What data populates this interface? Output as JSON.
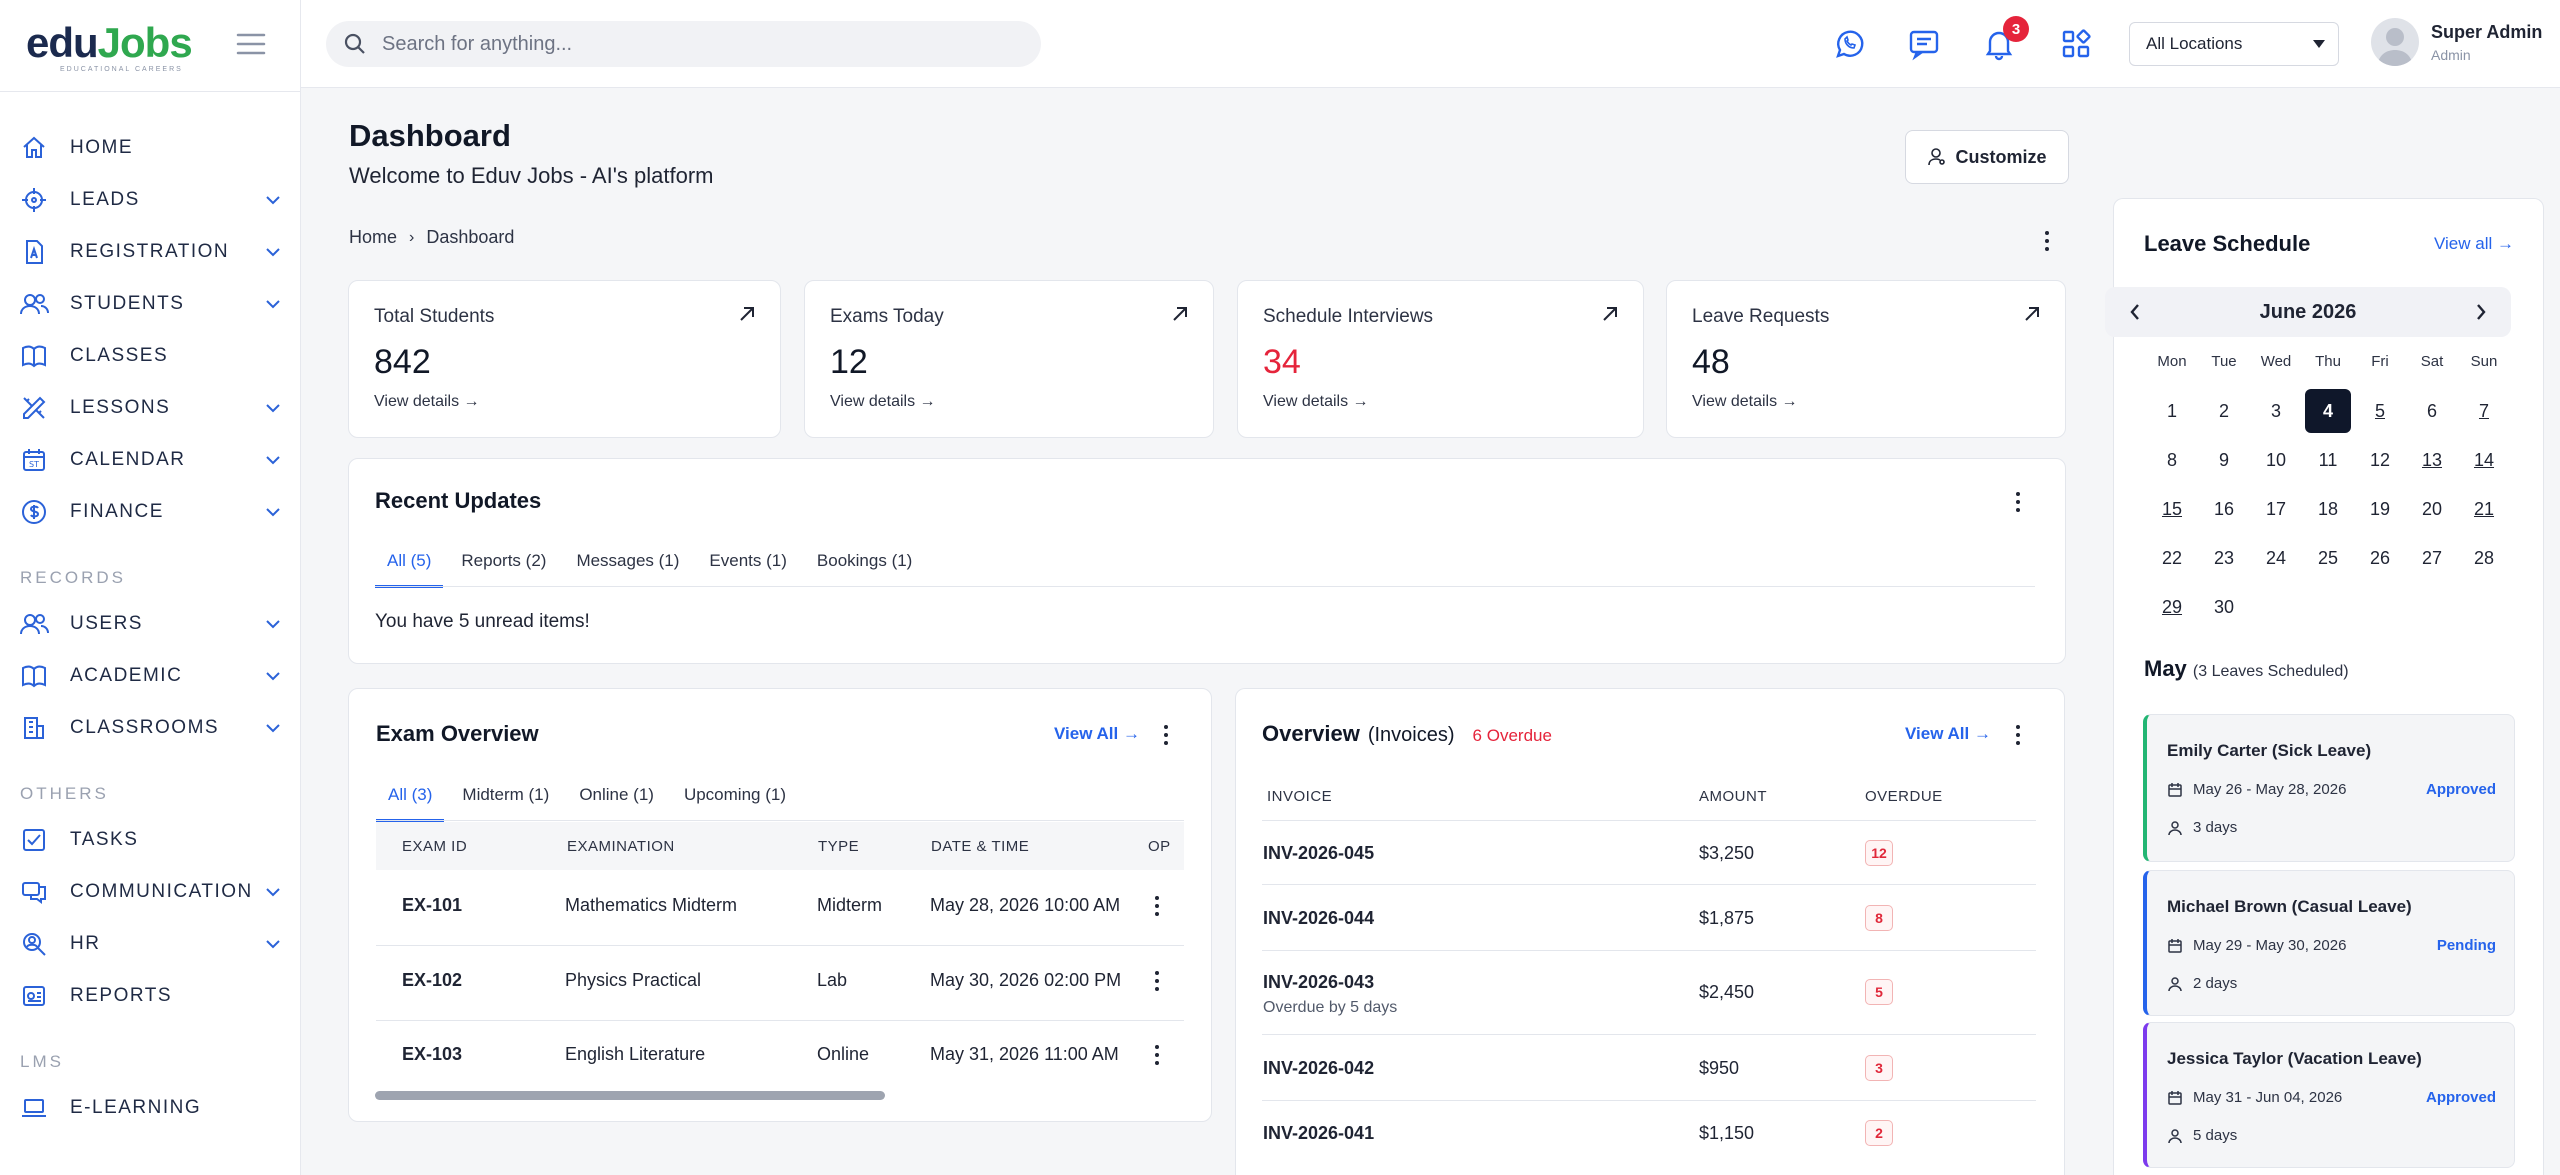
{
  "brand": {
    "logo_part1": "edu",
    "logo_part2": "Jobs",
    "logo_sub": "EDUCATIONAL CAREERS"
  },
  "sidebar": {
    "groups": [
      {
        "items": [
          {
            "label": "HOME",
            "icon": "home-icon",
            "expandable": false
          },
          {
            "label": "LEADS",
            "icon": "target-icon",
            "expandable": true
          },
          {
            "label": "REGISTRATION",
            "icon": "document-icon",
            "expandable": true
          },
          {
            "label": "STUDENTS",
            "icon": "users-icon",
            "expandable": true
          },
          {
            "label": "CLASSES",
            "icon": "book-icon",
            "expandable": false
          },
          {
            "label": "LESSONS",
            "icon": "pencil-ruler-icon",
            "expandable": true
          },
          {
            "label": "CALENDAR",
            "icon": "calendar-icon",
            "expandable": true
          },
          {
            "label": "FINANCE",
            "icon": "dollar-icon",
            "expandable": true
          }
        ]
      },
      {
        "title": "RECORDS",
        "items": [
          {
            "label": "USERS",
            "icon": "users-icon",
            "expandable": true
          },
          {
            "label": "ACADEMIC",
            "icon": "book-icon",
            "expandable": true
          },
          {
            "label": "CLASSROOMS",
            "icon": "building-icon",
            "expandable": true
          }
        ]
      },
      {
        "title": "OTHERS",
        "items": [
          {
            "label": "TASKS",
            "icon": "checkbox-icon",
            "expandable": false
          },
          {
            "label": "COMMUNICATION",
            "icon": "chat-icon",
            "expandable": true
          },
          {
            "label": "HR",
            "icon": "hr-search-icon",
            "expandable": true
          },
          {
            "label": "REPORTS",
            "icon": "report-icon",
            "expandable": false
          }
        ]
      },
      {
        "title": "LMS",
        "items": [
          {
            "label": "E-LEARNING",
            "icon": "laptop-icon",
            "expandable": false
          }
        ]
      }
    ]
  },
  "topbar": {
    "search_placeholder": "Search for anything...",
    "notification_count": "3",
    "location": "All Locations",
    "user_name": "Super Admin",
    "user_role": "Admin"
  },
  "header": {
    "title": "Dashboard",
    "subtitle": "Welcome to Eduv Jobs - AI's platform",
    "customize_label": "Customize",
    "breadcrumb": [
      "Home",
      "Dashboard"
    ]
  },
  "stats": [
    {
      "label": "Total Students",
      "value": "842",
      "link": "View details",
      "value_color": "#111827"
    },
    {
      "label": "Exams Today",
      "value": "12",
      "link": "View details",
      "value_color": "#111827"
    },
    {
      "label": "Schedule Interviews",
      "value": "34",
      "link": "View details",
      "value_color": "#e5243b"
    },
    {
      "label": "Leave Requests",
      "value": "48",
      "link": "View details",
      "value_color": "#111827"
    }
  ],
  "recent": {
    "title": "Recent Updates",
    "tabs": [
      "All (5)",
      "Reports (2)",
      "Messages (1)",
      "Events (1)",
      "Bookings (1)"
    ],
    "message": "You have 5 unread items!"
  },
  "exams": {
    "title": "Exam Overview",
    "view_all": "View All",
    "tabs": [
      "All (3)",
      "Midterm (1)",
      "Online (1)",
      "Upcoming (1)"
    ],
    "columns": [
      "EXAM ID",
      "EXAMINATION",
      "TYPE",
      "DATE & TIME",
      "OP"
    ],
    "rows": [
      {
        "id": "EX-101",
        "name": "Mathematics Midterm",
        "type": "Midterm",
        "datetime": "May 28, 2026 10:00 AM"
      },
      {
        "id": "EX-102",
        "name": "Physics Practical",
        "type": "Lab",
        "datetime": "May 30, 2026 02:00 PM"
      },
      {
        "id": "EX-103",
        "name": "English Literature",
        "type": "Online",
        "datetime": "May 31, 2026 11:00 AM"
      }
    ]
  },
  "invoices": {
    "title": "Overview",
    "title_suffix": "(Invoices)",
    "overdue_badge": "6 Overdue",
    "view_all": "View All",
    "columns": [
      "INVOICE",
      "AMOUNT",
      "OVERDUE"
    ],
    "rows": [
      {
        "invoice": "INV-2026-045",
        "note": "",
        "amount": "$3,250",
        "overdue": "12"
      },
      {
        "invoice": "INV-2026-044",
        "note": "",
        "amount": "$1,875",
        "overdue": "8"
      },
      {
        "invoice": "INV-2026-043",
        "note": "Overdue by 5 days",
        "amount": "$2,450",
        "overdue": "5"
      },
      {
        "invoice": "INV-2026-042",
        "note": "",
        "amount": "$950",
        "overdue": "3"
      },
      {
        "invoice": "INV-2026-041",
        "note": "",
        "amount": "$1,150",
        "overdue": "2"
      }
    ]
  },
  "leave": {
    "title": "Leave Schedule",
    "view_all": "View all",
    "month_label": "June 2026",
    "weekdays": [
      "Mon",
      "Tue",
      "Wed",
      "Thu",
      "Fri",
      "Sat",
      "Sun"
    ],
    "selected_day": "4",
    "weeks": [
      [
        "1",
        "2",
        "3",
        "4",
        "5",
        "6",
        "7"
      ],
      [
        "8",
        "9",
        "10",
        "11",
        "12",
        "13",
        "14"
      ],
      [
        "15",
        "16",
        "17",
        "18",
        "19",
        "20",
        "21"
      ],
      [
        "22",
        "23",
        "24",
        "25",
        "26",
        "27",
        "28"
      ],
      [
        "29",
        "30"
      ]
    ],
    "underlined_days": [
      "5",
      "7",
      "13",
      "14",
      "15",
      "21",
      "29"
    ],
    "summary_month": "May",
    "summary_count": "(3 Leaves Scheduled)",
    "entries": [
      {
        "name": "Emily Carter (Sick Leave)",
        "dates": "May 26 - May 28, 2026",
        "duration": "3 days",
        "status": "Approved",
        "accent": "#22b573"
      },
      {
        "name": "Michael Brown (Casual Leave)",
        "dates": "May 29 - May 30, 2026",
        "duration": "2 days",
        "status": "Pending",
        "accent": "#2563eb"
      },
      {
        "name": "Jessica Taylor (Vacation Leave)",
        "dates": "May 31 - Jun 04, 2026",
        "duration": "5 days",
        "status": "Approved",
        "accent": "#7c3aed"
      }
    ]
  },
  "colors": {
    "accent": "#2563eb",
    "danger": "#e5243b",
    "brand_green": "#2fa84f",
    "brand_navy": "#1b2a4e"
  }
}
